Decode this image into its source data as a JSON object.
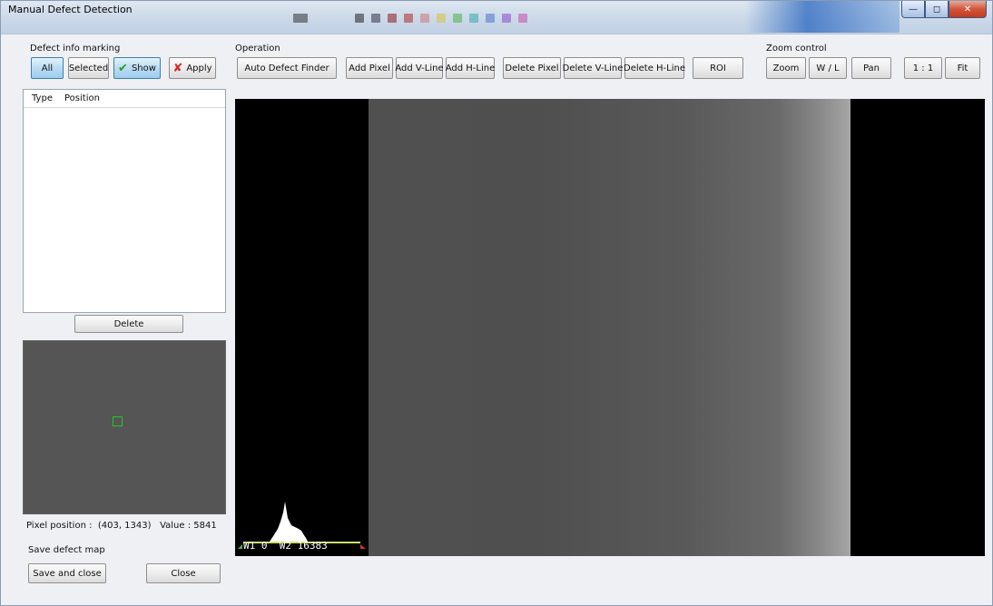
{
  "window": {
    "title": "Manual Defect Detection"
  },
  "defect_info": {
    "group_label": "Defect info marking",
    "buttons": {
      "all": "All",
      "selected": "Selected",
      "show": "Show",
      "apply": "Apply"
    },
    "list_columns": [
      "Type",
      "Position"
    ],
    "rows": [],
    "delete_label": "Delete"
  },
  "operation": {
    "group_label": "Operation",
    "buttons": {
      "auto_defect_finder": "Auto Defect Finder",
      "add_pixel": "Add Pixel",
      "add_vline": "Add V-Line",
      "add_hline": "Add H-Line",
      "delete_pixel": "Delete Pixel",
      "delete_vline": "Delete V-Line",
      "delete_hline": "Delete H-Line",
      "roi": "ROI"
    }
  },
  "zoom_control": {
    "group_label": "Zoom control",
    "buttons": {
      "zoom": "Zoom",
      "wl": "W / L",
      "pan": "Pan",
      "one_to_one": "1 : 1",
      "fit": "Fit"
    }
  },
  "pixel_info": {
    "position_label": "Pixel position :",
    "position_value": "(403, 1343)",
    "value_label": "Value :",
    "value": "5841"
  },
  "save_defect_map": {
    "group_label": "Save defect map",
    "save_and_close": "Save and close",
    "close": "Close"
  },
  "viewer": {
    "wl_text": "W1 0  W2 16383",
    "histogram_bar_color": "#c8e06a"
  },
  "colors": {
    "active_button": "#b9dcf3",
    "roi_marker": "#29c329",
    "viewer_background": "#000000"
  }
}
